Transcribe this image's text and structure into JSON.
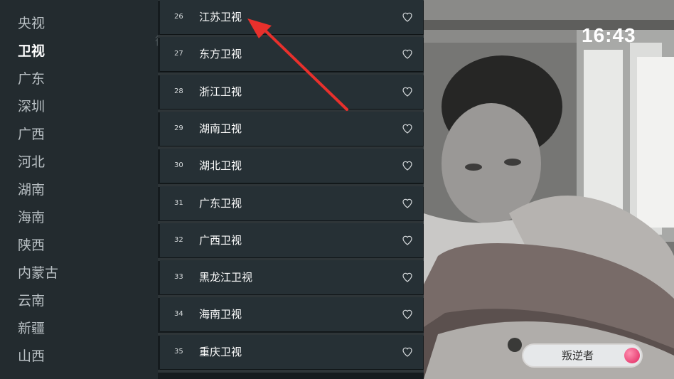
{
  "categories": [
    {
      "label": "央视",
      "active": false
    },
    {
      "label": "卫视",
      "active": true
    },
    {
      "label": "广东",
      "active": false
    },
    {
      "label": "深圳",
      "active": false
    },
    {
      "label": "广西",
      "active": false
    },
    {
      "label": "河北",
      "active": false
    },
    {
      "label": "湖南",
      "active": false
    },
    {
      "label": "海南",
      "active": false
    },
    {
      "label": "陕西",
      "active": false
    },
    {
      "label": "内蒙古",
      "active": false
    },
    {
      "label": "云南",
      "active": false
    },
    {
      "label": "新疆",
      "active": false
    },
    {
      "label": "山西",
      "active": false
    }
  ],
  "channels": [
    {
      "number": "26",
      "name": "江苏卫视",
      "icon": "heart-outline-icon"
    },
    {
      "number": "27",
      "name": "东方卫视",
      "icon": "heart-outline-icon"
    },
    {
      "number": "28",
      "name": "浙江卫视",
      "icon": "heart-outline-icon"
    },
    {
      "number": "29",
      "name": "湖南卫视",
      "icon": "heart-outline-icon"
    },
    {
      "number": "30",
      "name": "湖北卫视",
      "icon": "heart-outline-icon"
    },
    {
      "number": "31",
      "name": "广东卫视",
      "icon": "heart-outline-icon"
    },
    {
      "number": "32",
      "name": "广西卫视",
      "icon": "heart-outline-icon"
    },
    {
      "number": "33",
      "name": "黑龙江卫视",
      "icon": "heart-outline-icon"
    },
    {
      "number": "34",
      "name": "海南卫视",
      "icon": "heart-outline-icon"
    },
    {
      "number": "35",
      "name": "重庆卫视",
      "icon": "heart-outline-icon"
    }
  ],
  "clock": "16:43",
  "now_playing": {
    "title": "叛逆者"
  },
  "colors": {
    "sidebar_bg": "#232b2f",
    "row_bg": "#263035",
    "annotation_arrow": "#e8302c",
    "badge_accent": "#e0245e"
  }
}
